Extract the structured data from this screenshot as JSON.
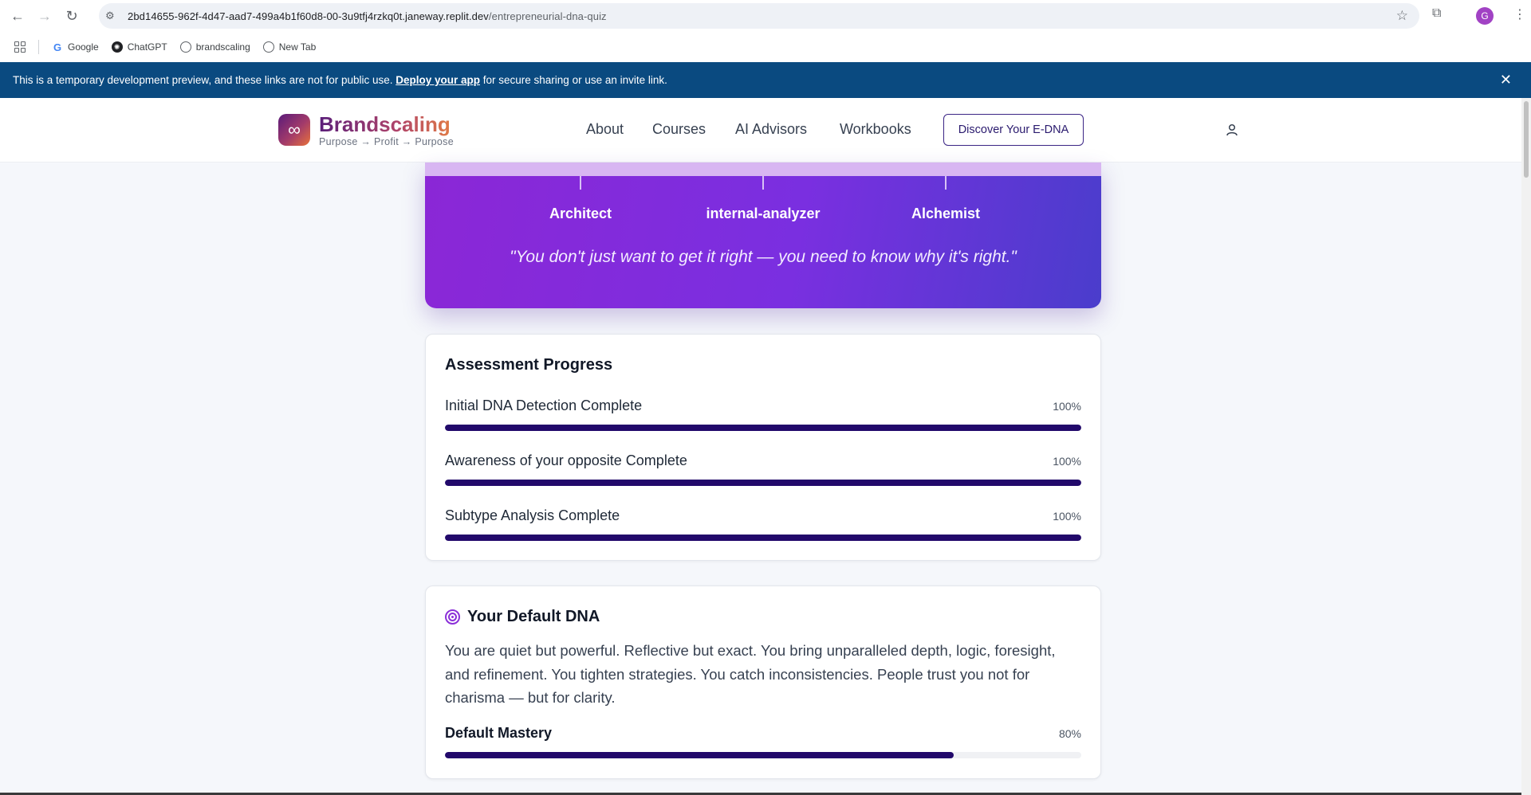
{
  "browser": {
    "url_host": "2bd14655-962f-4d47-aad7-499a4b1f60d8-00-3u9tfj4rzkq0t.janeway.replit.dev",
    "url_path": "/entrepreneurial-dna-quiz",
    "profile_initial": "G",
    "bookmarks": [
      {
        "label": "Google",
        "icon": "google-icon"
      },
      {
        "label": "ChatGPT",
        "icon": "chatgpt-icon"
      },
      {
        "label": "brandscaling",
        "icon": "globe-icon"
      },
      {
        "label": "New Tab",
        "icon": "globe-icon"
      }
    ]
  },
  "banner": {
    "text_before": "This is a temporary development preview, and these links are not for public use. ",
    "link": "Deploy your app",
    "text_after": " for secure sharing or use an invite link.",
    "close": "✕"
  },
  "header": {
    "logo_symbol": "∞",
    "brand": "Brandscaling",
    "tagline": "Purpose → Profit → Purpose",
    "nav": [
      "About",
      "Courses",
      "AI Advisors",
      "Workbooks"
    ],
    "cta": "Discover Your E-DNA"
  },
  "hero": {
    "types": [
      "Architect",
      "internal-analyzer",
      "Alchemist"
    ],
    "quote": "\"You don't just want to get it right — you need to know why it's right.\""
  },
  "progress": {
    "title": "Assessment Progress",
    "items": [
      {
        "label": "Initial DNA Detection Complete",
        "pct_label": "100%",
        "value": 100
      },
      {
        "label": "Awareness of your opposite Complete",
        "pct_label": "100%",
        "value": 100
      },
      {
        "label": "Subtype Analysis Complete",
        "pct_label": "100%",
        "value": 100
      }
    ]
  },
  "default_dna": {
    "title": "Your Default DNA",
    "description": "You are quiet but powerful. Reflective but exact. You bring unparalleled depth, logic, foresight, and refinement. You tighten strategies. You catch inconsistencies. People trust you not for charisma — but for clarity.",
    "mastery_label": "Default Mastery",
    "mastery_pct_label": "80%",
    "mastery_value": 80
  },
  "colors": {
    "banner": "#0a4a80",
    "progress_fill": "#22096b",
    "hero_start": "#8b27d6",
    "hero_end": "#4a3dcc",
    "accent": "#8b30d8"
  }
}
